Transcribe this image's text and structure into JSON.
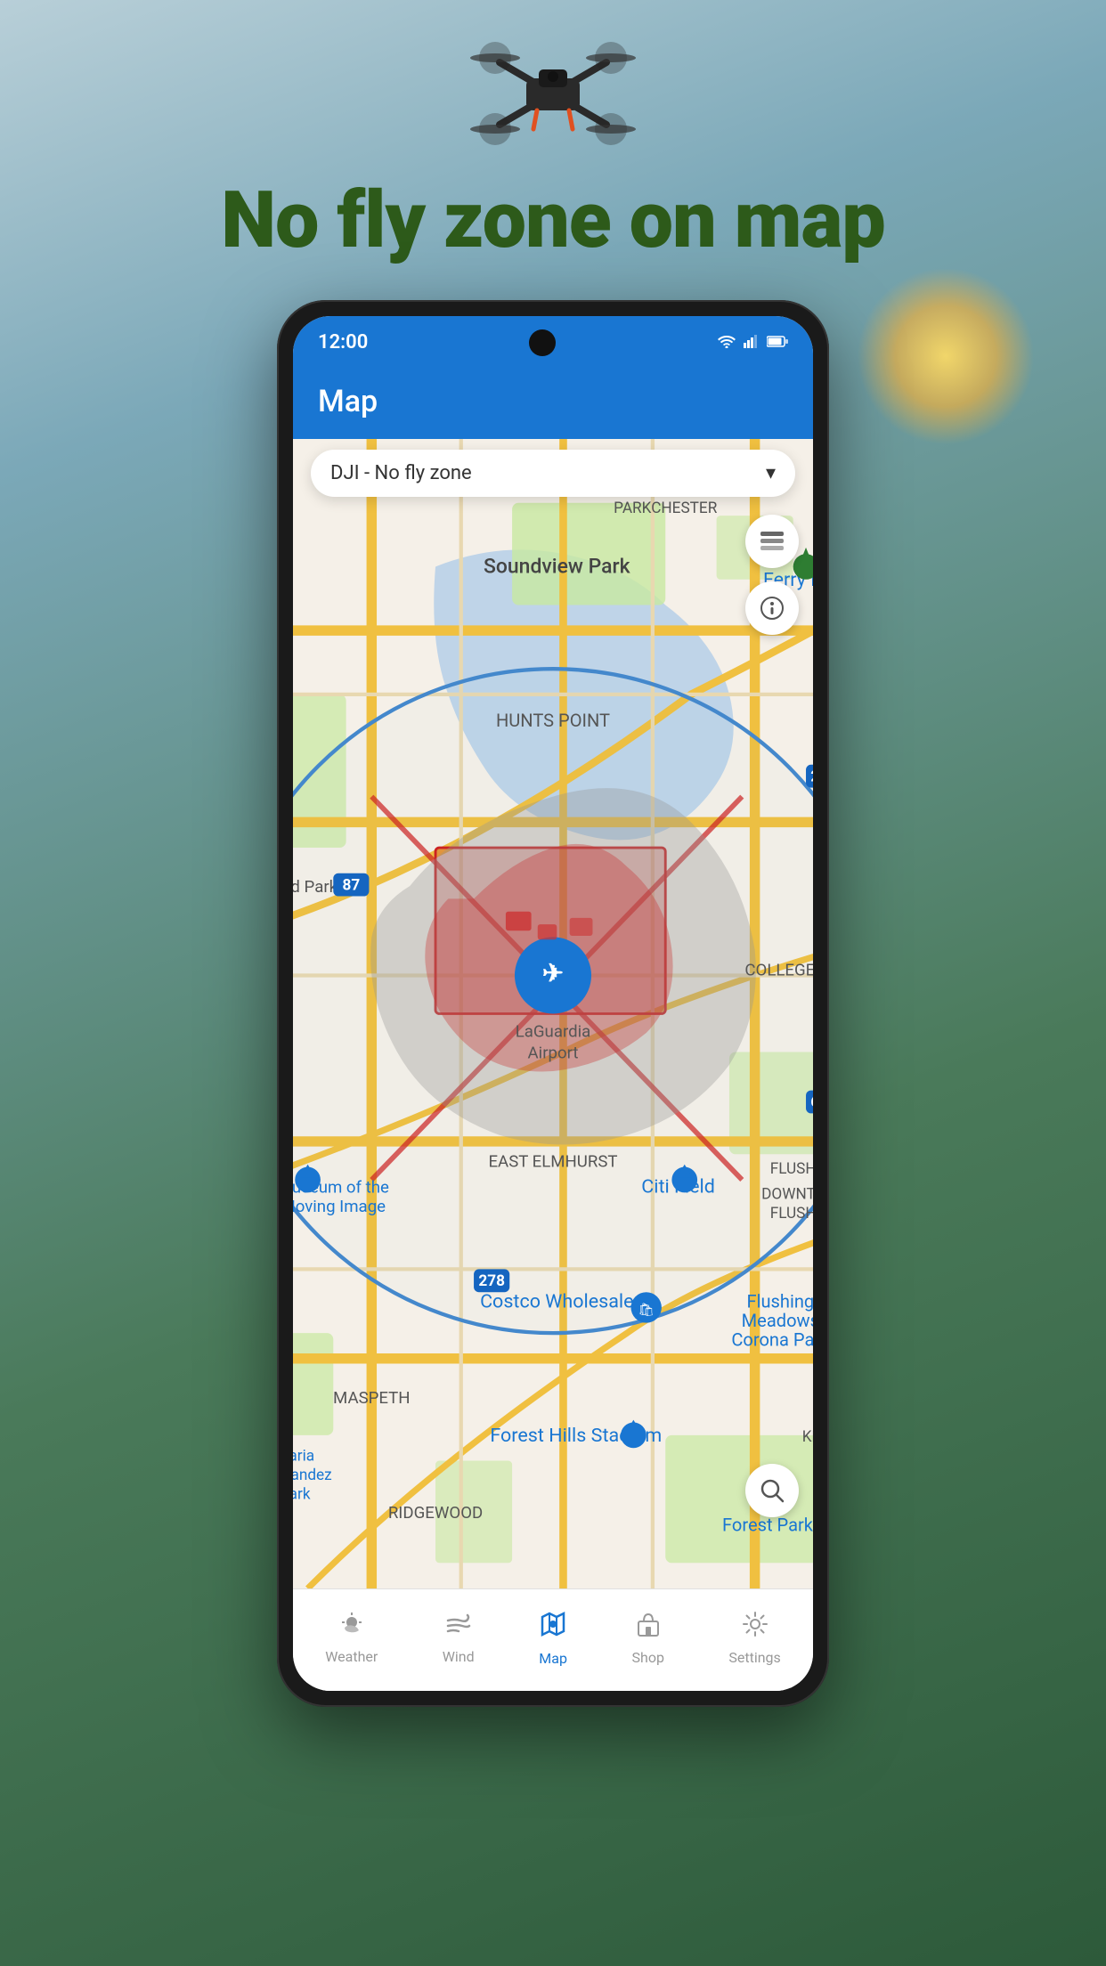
{
  "page": {
    "title": "No fly zone on map",
    "background_colors": {
      "sky": "#b8cfd8",
      "forest": "#2d5a3a"
    }
  },
  "status_bar": {
    "time": "12:00",
    "wifi_icon": "wifi",
    "signal_icon": "signal",
    "battery_icon": "battery"
  },
  "header": {
    "title": "Map"
  },
  "map": {
    "dropdown": {
      "label": "DJI - No fly zone",
      "chevron": "▾"
    },
    "airport_label": "LaGuardia\nAirport",
    "nearby_labels": [
      "Soundview Park",
      "Ferry Poin",
      "HUNTS POINT",
      "dall's Island Park",
      "COLLEGE POINT",
      "EAST ELMHURST",
      "Museum of the Moving Image",
      "Citi Field",
      "FLUSHING",
      "DOWNTOWN FLUSHING",
      "Costco Wholesale",
      "Flushing Meadows Corona Park",
      "MASPETH",
      "Forest Hills Stadium",
      "Maria Hernandez Park",
      "RIDGEWOOD",
      "Forest Park",
      "KEW GARDE HILLS",
      "PARKCHESTER"
    ],
    "buttons": {
      "layers": "⊞",
      "info": "ℹ",
      "search": "🔍"
    }
  },
  "bottom_nav": {
    "items": [
      {
        "id": "weather",
        "label": "Weather",
        "icon": "☀",
        "active": false
      },
      {
        "id": "wind",
        "label": "Wind",
        "icon": "💨",
        "active": false
      },
      {
        "id": "map",
        "label": "Map",
        "icon": "📍",
        "active": true
      },
      {
        "id": "shop",
        "label": "Shop",
        "icon": "🛍",
        "active": false
      },
      {
        "id": "settings",
        "label": "Settings",
        "icon": "⚙",
        "active": false
      }
    ]
  }
}
